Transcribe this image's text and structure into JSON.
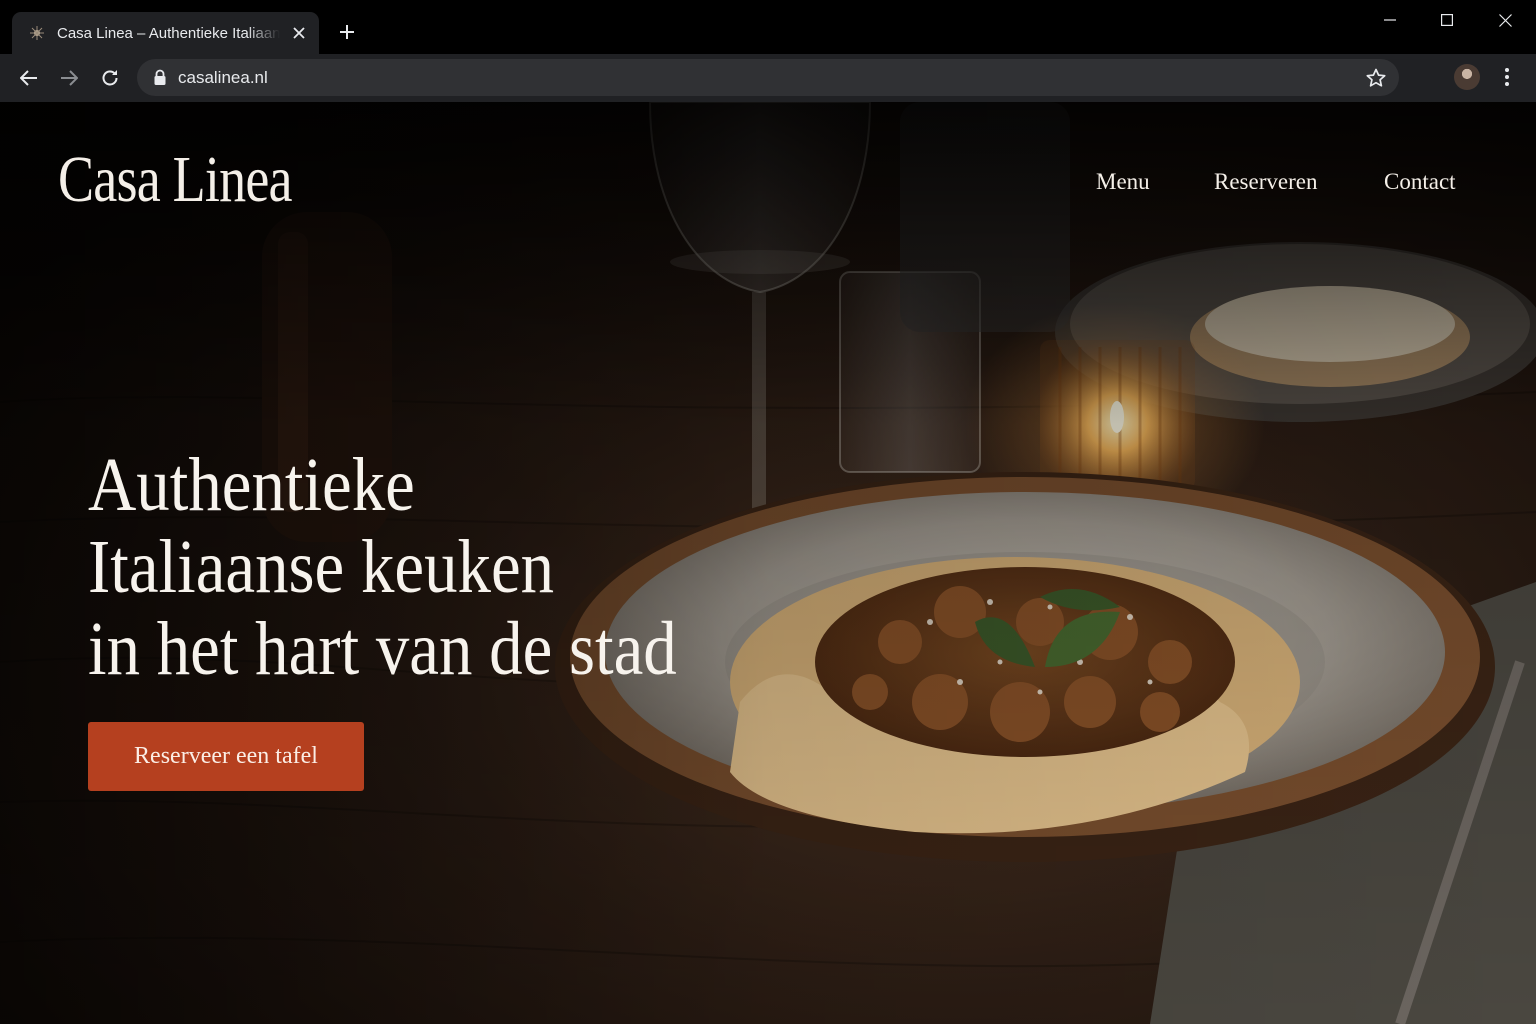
{
  "browser": {
    "tab_title": "Casa Linea – Authentieke Italiaanse keuken",
    "url": "casalinea.nl"
  },
  "site": {
    "logo": "Casa Linea",
    "nav": [
      "Menu",
      "Reserveren",
      "Contact"
    ],
    "hero": {
      "lines": [
        "Authentieke",
        "Italiaanse keuken",
        "in het hart van de stad"
      ]
    },
    "cta_label": "Reserveer een tafel"
  },
  "colors": {
    "accent": "#b5401f",
    "text_light": "#f7f3ed",
    "browser_dark": "#202124"
  }
}
